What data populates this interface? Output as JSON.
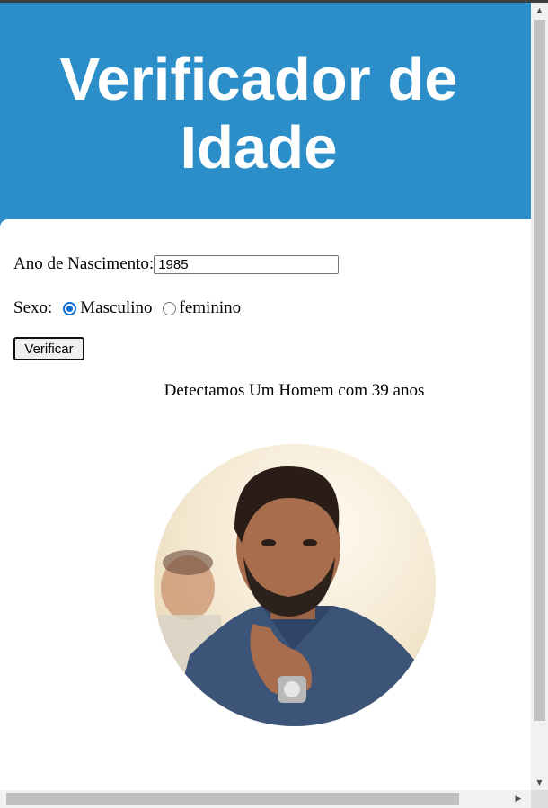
{
  "header": {
    "title": "Verificador de Idade"
  },
  "form": {
    "year_label": "Ano de Nascimento:",
    "year_value": "1985",
    "sex_label": "Sexo:",
    "options": [
      {
        "label": "Masculino",
        "checked": true
      },
      {
        "label": "feminino",
        "checked": false
      }
    ],
    "button_label": "Verificar"
  },
  "result": {
    "text": "Detectamos Um Homem com 39 anos"
  },
  "photo": {
    "description_icon": "man-portrait-photo"
  },
  "colors": {
    "header_bg": "#2b8ec9",
    "radio_accent": "#0b6fd6"
  },
  "scrollbars": {
    "up_arrow": "▲",
    "down_arrow": "▼",
    "right_arrow": "▶"
  }
}
